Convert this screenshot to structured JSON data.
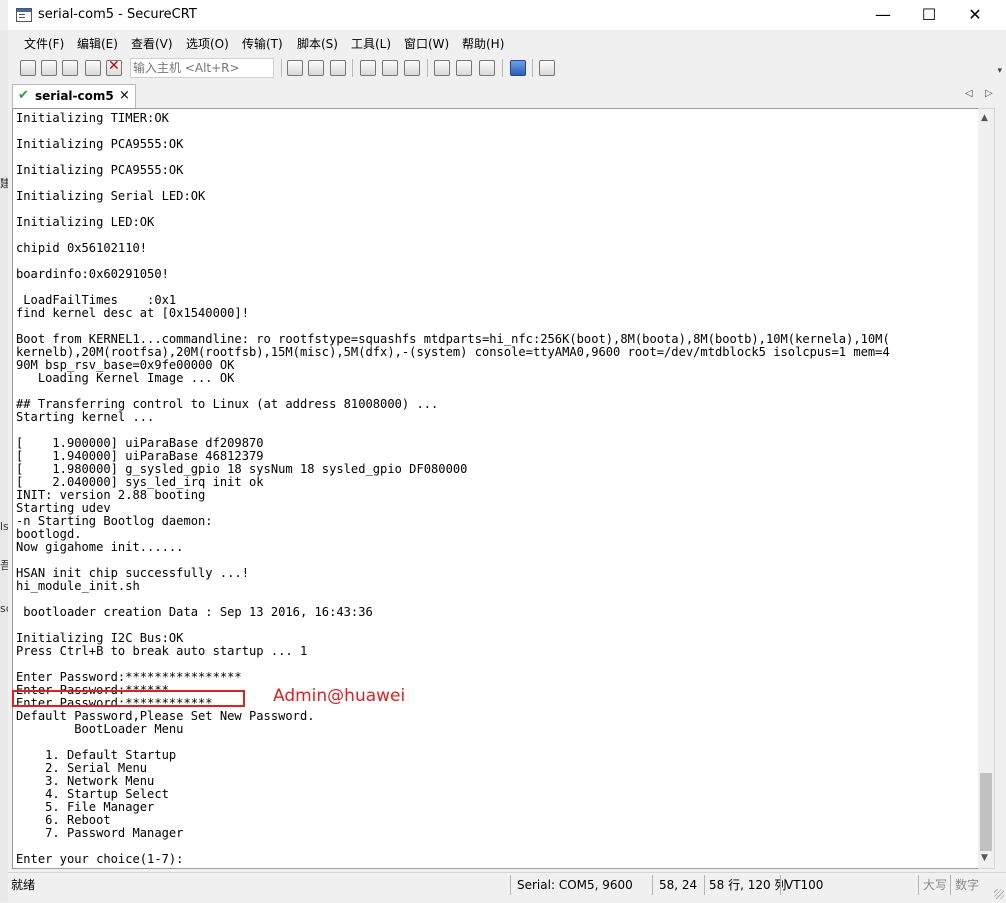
{
  "window": {
    "title": "serial-com5 - SecureCRT",
    "minimize_glyph": "—",
    "maximize_glyph": "☐",
    "close_glyph": "✕"
  },
  "menu": [
    "文件(F)",
    "编辑(E)",
    "查看(V)",
    "选项(O)",
    "传输(T)",
    "脚本(S)",
    "工具(L)",
    "窗口(W)",
    "帮助(H)"
  ],
  "toolbar": {
    "host_placeholder": "输入主机 <Alt+R>",
    "icons": [
      "connect-icon",
      "quick-connect-icon",
      "connect-tab-icon",
      "reconnect-icon",
      "disconnect-icon",
      "copy-icon",
      "paste-icon",
      "find-icon",
      "print-icon",
      "print-setup-icon",
      "log-icon",
      "session-options-icon",
      "global-options-icon",
      "keymap-icon",
      "help-icon",
      "sftp-icon"
    ]
  },
  "tab": {
    "label": "serial-com5",
    "close_glyph": "×",
    "status_icon": "connected-check-icon"
  },
  "terminal": {
    "lines": [
      "Initializing TIMER:OK",
      "",
      "Initializing PCA9555:OK",
      "",
      "Initializing PCA9555:OK",
      "",
      "Initializing Serial LED:OK",
      "",
      "Initializing LED:OK",
      "",
      "chipid 0x56102110!",
      "",
      "boardinfo:0x60291050!",
      "",
      " LoadFailTimes    :0x1",
      "find kernel desc at [0x1540000]!",
      "",
      "Boot from KERNEL1...commandline: ro rootfstype=squashfs mtdparts=hi_nfc:256K(boot),8M(boota),8M(bootb),10M(kernela),10M(",
      "kernelb),20M(rootfsa),20M(rootfsb),15M(misc),5M(dfx),-(system) console=ttyAMA0,9600 root=/dev/mtdblock5 isolcpus=1 mem=4",
      "90M bsp_rsv_base=0x9fe00000 OK",
      "   Loading Kernel Image ... OK",
      "",
      "## Transferring control to Linux (at address 81008000) ...",
      "Starting kernel ...",
      "",
      "[    1.900000] uiParaBase df209870",
      "[    1.940000] uiParaBase 46812379",
      "[    1.980000] g_sysled_gpio 18 sysNum 18 sysled_gpio DF080000",
      "[    2.040000] sys_led_irq init ok",
      "INIT: version 2.88 booting",
      "Starting udev",
      "-n Starting Bootlog daemon:",
      "bootlogd.",
      "Now gigahome init......",
      "",
      "HSAN init chip successfully ...!",
      "hi_module_init.sh",
      "",
      " bootloader creation Data : Sep 13 2016, 16:43:36",
      "",
      "Initializing I2C Bus:OK",
      "Press Ctrl+B to break auto startup ... 1",
      "",
      "Enter Password:****************",
      "Enter Password:******",
      "Enter Password:************",
      "Default Password,Please Set New Password.",
      "        BootLoader Menu",
      "",
      "    1. Default Startup",
      "    2. Serial Menu",
      "    3. Network Menu",
      "    4. Startup Select",
      "    5. File Manager",
      "    6. Reboot",
      "    7. Password Manager",
      "",
      "Enter your choice(1-7):"
    ]
  },
  "annotation": {
    "text": "Admin@huawei",
    "color": "#e02020"
  },
  "statusbar": {
    "ready": "就绪",
    "serial": "Serial: COM5, 9600",
    "cursor": "58,  24",
    "size": "58 行, 120 列",
    "emulation": "VT100",
    "caps": "大写",
    "num": "数字"
  },
  "left_edge_fragments": [
    ",",
    "建",
    "ls",
    "吾",
    "sc"
  ]
}
